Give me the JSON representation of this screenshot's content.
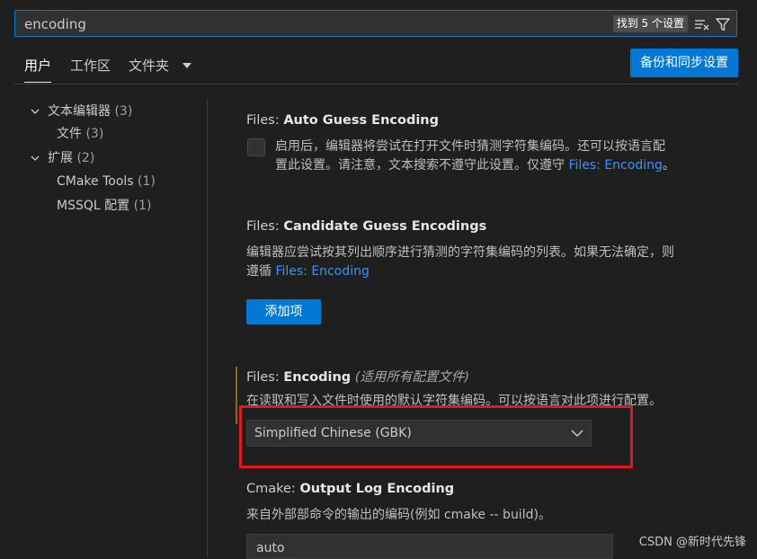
{
  "search": {
    "value": "encoding",
    "result_badge": "找到 5 个设置"
  },
  "tabs": [
    {
      "label": "用户",
      "active": true
    },
    {
      "label": "工作区",
      "active": false
    },
    {
      "label": "文件夹",
      "active": false
    }
  ],
  "sync_button": "备份和同步设置",
  "toc": {
    "items": [
      {
        "label": "文本编辑器",
        "count": "(3)"
      },
      {
        "label": "文件",
        "count": "(3)"
      },
      {
        "label": "扩展",
        "count": "(2)"
      },
      {
        "label": "CMake Tools",
        "count": "(1)"
      },
      {
        "label": "MSSQL 配置",
        "count": "(1)"
      }
    ]
  },
  "settings": {
    "auto_guess": {
      "category": "Files: ",
      "name": "Auto Guess Encoding",
      "desc_line1": "启用后，编辑器将尝试在打开文件时猜测字符集编码。还可以按语言配",
      "desc_line2": "置此设置。请注意，文本搜索不遵守此设置。仅遵守 ",
      "link": "Files: Encoding",
      "desc_end": "。"
    },
    "candidate": {
      "category": "Files: ",
      "name": "Candidate Guess Encodings",
      "desc_line1": "编辑器应尝试按其列出顺序进行猜测的字符集编码的列表。如果无法确定，则",
      "desc_line2": "遵循 ",
      "link": "Files: Encoding",
      "add_button": "添加项"
    },
    "encoding": {
      "category": "Files: ",
      "name": "Encoding",
      "scope": "(适用所有配置文件)",
      "desc": "在读取和写入文件时使用的默认字符集编码。可以按语言对此项进行配置。",
      "value": "Simplified Chinese (GBK)"
    },
    "cmake": {
      "category": "Cmake: ",
      "name": "Output Log Encoding",
      "desc": "来自外部部命令的输出的编码(例如 cmake -- build)。",
      "value": "auto"
    }
  },
  "watermark": "CSDN @新时代先锋",
  "colors": {
    "accent": "#0078d4",
    "link": "#3794ff",
    "highlight_box": "#e0191f",
    "modified_bar": "#8f6a1c"
  }
}
